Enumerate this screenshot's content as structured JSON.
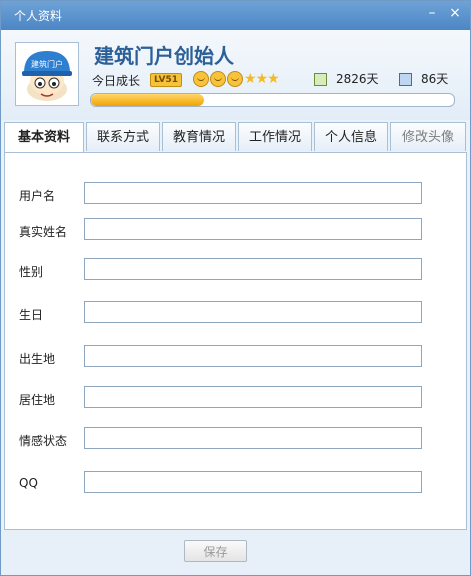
{
  "window": {
    "title": "个人资料",
    "minimize": "–",
    "close": "×"
  },
  "profile": {
    "nickname": "建筑门户创始人",
    "growth_label": "今日成长",
    "level": "LV51",
    "faces": 3,
    "stars": 3,
    "active_days": "2826天",
    "online_days": "86天",
    "progress": 0.31
  },
  "avatar": {
    "hat_text": "建筑门户"
  },
  "tabs": [
    {
      "label": "基本资料"
    },
    {
      "label": "联系方式"
    },
    {
      "label": "教育情况"
    },
    {
      "label": "工作情况"
    },
    {
      "label": "个人信息"
    },
    {
      "label": "修改头像"
    }
  ],
  "form": {
    "fields": [
      {
        "label": "用户名",
        "value": ""
      },
      {
        "label": "真实姓名",
        "value": ""
      },
      {
        "label": "性别",
        "value": ""
      },
      {
        "label": "生日",
        "value": ""
      },
      {
        "label": "出生地",
        "value": ""
      },
      {
        "label": "居住地",
        "value": ""
      },
      {
        "label": "情感状态",
        "value": ""
      },
      {
        "label": "QQ",
        "value": ""
      }
    ]
  },
  "footer": {
    "save_label": "保存"
  },
  "colors": {
    "accent": "#4b86c4",
    "progress": "#f2a300"
  }
}
